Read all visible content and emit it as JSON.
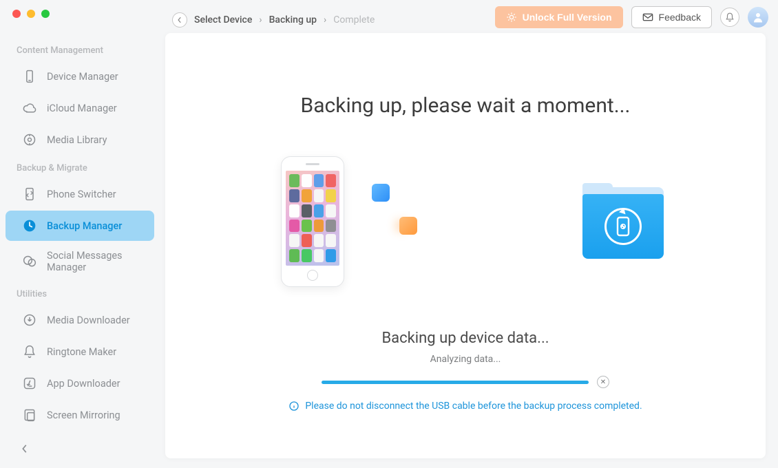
{
  "toolbar": {
    "unlock_label": "Unlock Full Version",
    "feedback_label": "Feedback"
  },
  "breadcrumb": {
    "items": [
      "Select Device",
      "Backing up",
      "Complete"
    ],
    "active_index": 1
  },
  "sidebar": {
    "sections": [
      {
        "title": "Content Management",
        "items": [
          {
            "id": "device-manager",
            "label": "Device Manager",
            "icon": "device-icon"
          },
          {
            "id": "icloud-manager",
            "label": "iCloud Manager",
            "icon": "cloud-icon"
          },
          {
            "id": "media-library",
            "label": "Media Library",
            "icon": "disc-icon"
          }
        ]
      },
      {
        "title": "Backup & Migrate",
        "items": [
          {
            "id": "phone-switcher",
            "label": "Phone Switcher",
            "icon": "switch-icon"
          },
          {
            "id": "backup-manager",
            "label": "Backup Manager",
            "icon": "clock-icon",
            "active": true
          },
          {
            "id": "social-messages",
            "label": "Social Messages Manager",
            "icon": "chat-icon"
          }
        ]
      },
      {
        "title": "Utilities",
        "items": [
          {
            "id": "media-downloader",
            "label": "Media Downloader",
            "icon": "download-icon"
          },
          {
            "id": "ringtone-maker",
            "label": "Ringtone Maker",
            "icon": "bell-outline-icon"
          },
          {
            "id": "app-downloader",
            "label": "App Downloader",
            "icon": "appstore-icon"
          },
          {
            "id": "screen-mirroring",
            "label": "Screen Mirroring",
            "icon": "mirror-icon"
          }
        ]
      }
    ]
  },
  "main": {
    "hero_title": "Backing up, please wait a moment...",
    "status_title": "Backing up device data...",
    "status_sub": "Analyzing data...",
    "progress_percent": 100,
    "warning": "Please do not disconnect the USB cable before the backup process completed."
  },
  "phone": {
    "app_colors": [
      "#6bbb5c",
      "#fefefe",
      "#5f9ee9",
      "#f06464",
      "#5e6b9e",
      "#f1a33a",
      "#f6f6f6",
      "#f2d24a",
      "#fefefe",
      "#5b5f66",
      "#4aa1e8",
      "#f6f6f6",
      "#e45aa7",
      "#6ac24d",
      "#ee9a3a",
      "#8f8f93",
      "#f6f6f6",
      "#ee5f56",
      "#f6f6f6",
      "#f6f6f6",
      "#5fbb54",
      "#48c864",
      "#f6f6f6",
      "#2f9be8"
    ]
  }
}
